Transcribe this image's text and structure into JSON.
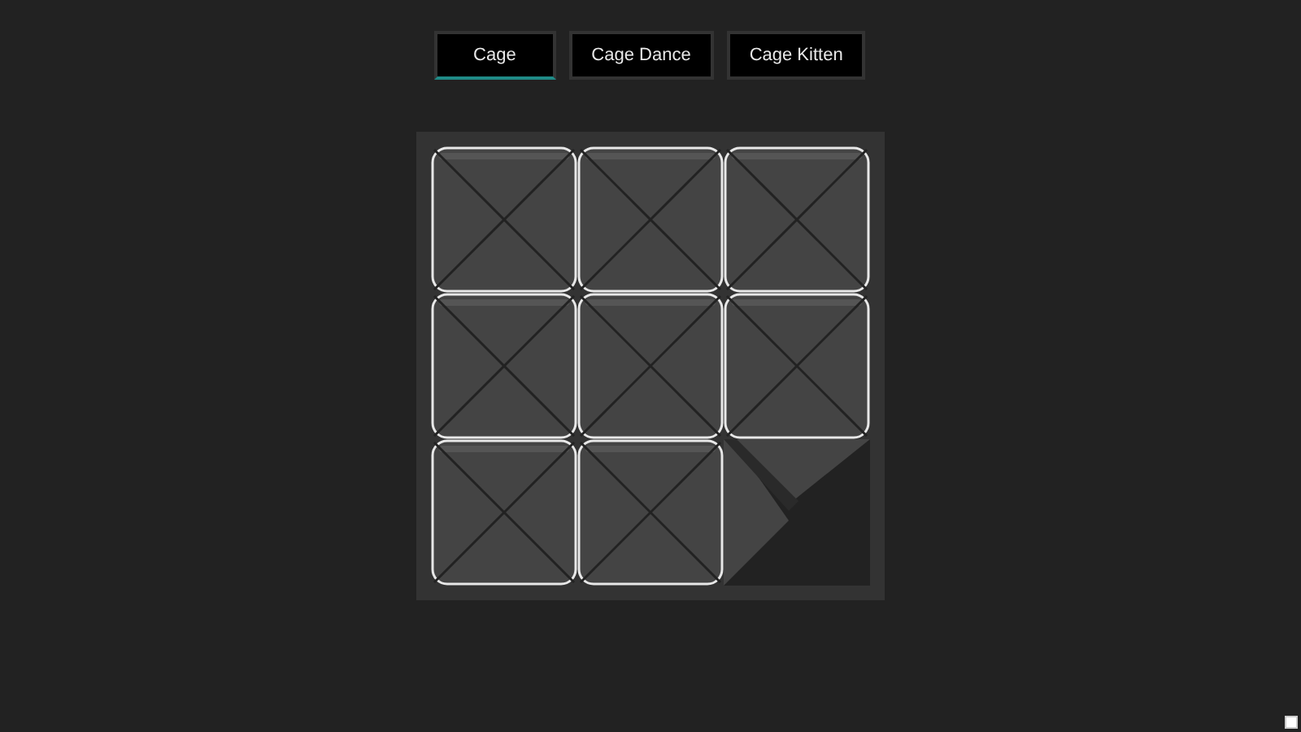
{
  "tabs": [
    {
      "label": "Cage",
      "selected": true
    },
    {
      "label": "Cage Dance",
      "selected": false
    },
    {
      "label": "Cage Kitten",
      "selected": false
    }
  ],
  "board": {
    "cells": [
      {
        "kind": "tile"
      },
      {
        "kind": "tile"
      },
      {
        "kind": "tile"
      },
      {
        "kind": "tile"
      },
      {
        "kind": "tile"
      },
      {
        "kind": "tile"
      },
      {
        "kind": "tile"
      },
      {
        "kind": "tile"
      },
      {
        "kind": "empty"
      }
    ]
  }
}
